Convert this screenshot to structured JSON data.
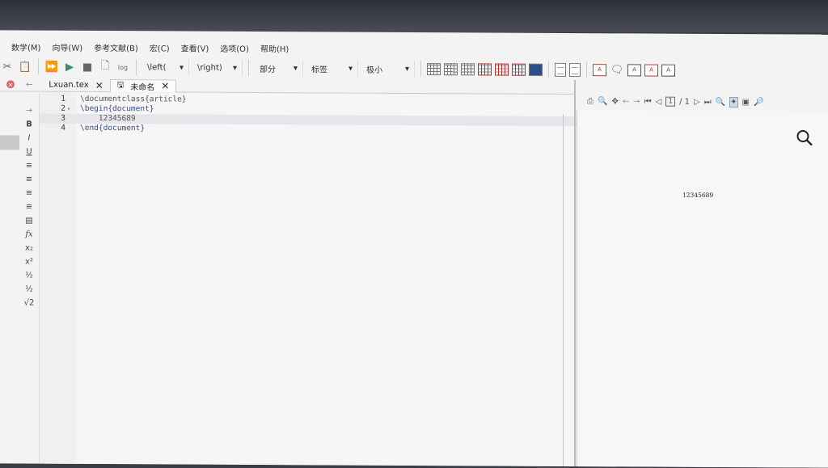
{
  "menu": [
    "数学(M)",
    "向导(W)",
    "参考文献(B)",
    "宏(C)",
    "查看(V)",
    "选项(O)",
    "帮助(H)"
  ],
  "toolbar": {
    "log_label": "log",
    "left_delim": "\\left(",
    "right_delim": "\\right)",
    "section": "部分",
    "label": "标签",
    "size": "极小"
  },
  "tabs": [
    {
      "label": "Lxuan.tex"
    },
    {
      "label": "未命名"
    }
  ],
  "side_tools": [
    "B",
    "I",
    "U",
    "≡",
    "≡",
    "≡",
    "≡",
    "▤",
    "fx",
    "x₂",
    "x²",
    "½",
    "½",
    "√2"
  ],
  "editor": {
    "lines": [
      {
        "num": "1",
        "code": "\\documentclass{article}"
      },
      {
        "num": "2",
        "code": "\\begin{document}"
      },
      {
        "num": "3",
        "code": "    12345689"
      },
      {
        "num": "4",
        "code": "\\end{document}"
      }
    ]
  },
  "viewer": {
    "page_current": "1",
    "page_total": "/ 1",
    "rendered_text": "12345689"
  }
}
